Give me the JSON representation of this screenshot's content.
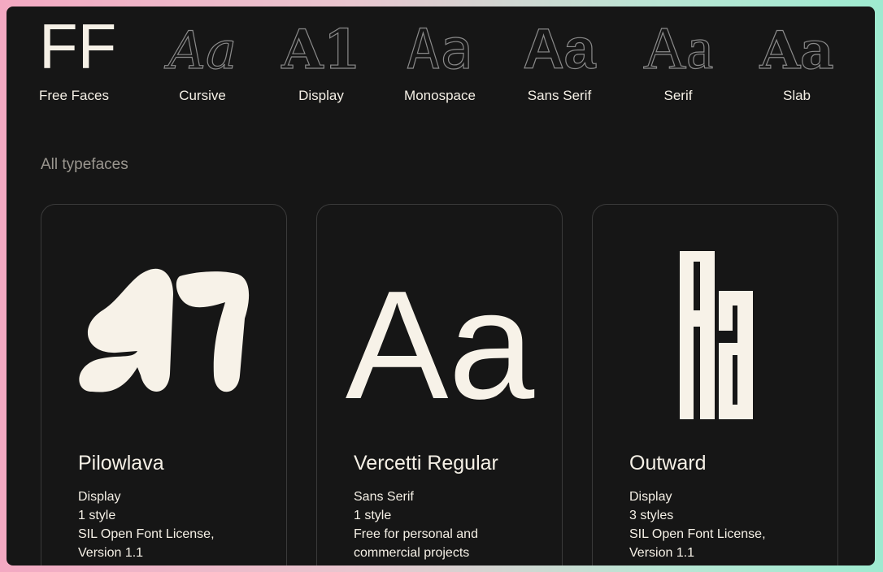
{
  "nav": {
    "logo": {
      "glyph": "FF",
      "label": "Free Faces"
    },
    "categories": [
      {
        "label": "Cursive",
        "glyph": "Aa",
        "icon": "cursive-aa-icon"
      },
      {
        "label": "Display",
        "glyph": "A1",
        "icon": "display-a1-icon"
      },
      {
        "label": "Monospace",
        "glyph": "Aa",
        "icon": "monospace-aa-icon"
      },
      {
        "label": "Sans Serif",
        "glyph": "Aa",
        "icon": "sans-serif-aa-icon"
      },
      {
        "label": "Serif",
        "glyph": "Aa",
        "icon": "serif-aa-icon"
      },
      {
        "label": "Slab",
        "glyph": "Aa",
        "icon": "slab-aa-icon"
      }
    ]
  },
  "section_title": "All typefaces",
  "cards": [
    {
      "name": "Pilowlava",
      "category": "Display",
      "styles": "1 style",
      "license_line1": "SIL Open Font License,",
      "license_line2": "Version 1.1",
      "preview": "A1"
    },
    {
      "name": "Vercetti Regular",
      "category": "Sans Serif",
      "styles": "1 style",
      "license_line1": "Free for personal and",
      "license_line2": "commercial projects",
      "preview": "Aa"
    },
    {
      "name": "Outward",
      "category": "Display",
      "styles": "3 styles",
      "license_line1": "SIL Open Font License,",
      "license_line2": "Version 1.1",
      "preview": "Aa"
    }
  ],
  "colors": {
    "background": "#161616",
    "text": "#f5f0e6",
    "muted": "#9a968f",
    "card_border": "#3a3a3a",
    "outline_glyph": "#8a8a8a"
  }
}
